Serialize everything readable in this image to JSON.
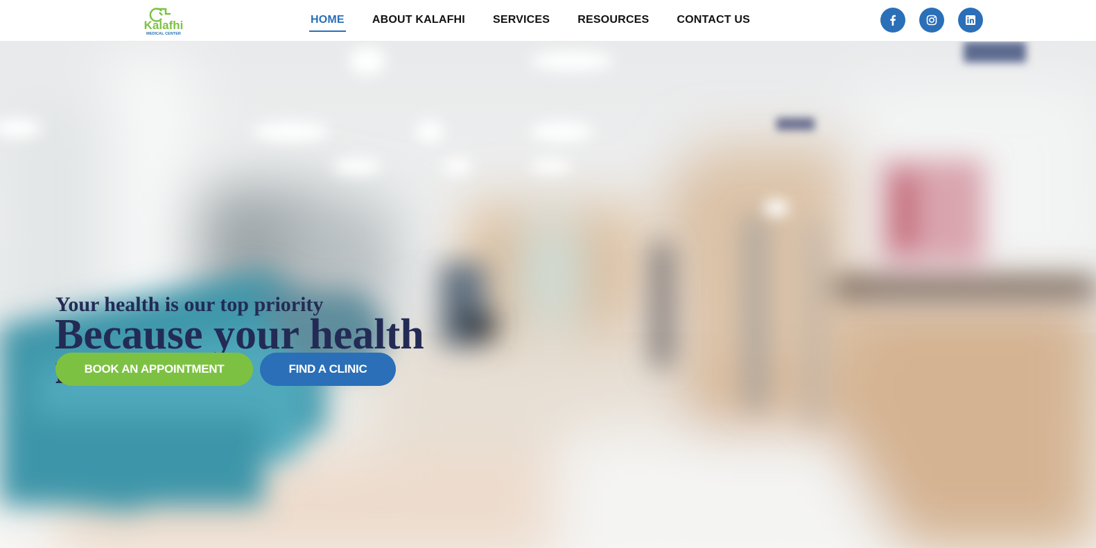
{
  "brand": {
    "logo_name": "Kalafhi",
    "logo_subtitle": "MEDICAL CENTER",
    "green": "#7dc143",
    "blue": "#2a6fb8",
    "navy": "#232b55"
  },
  "nav": {
    "items": [
      {
        "label": "HOME",
        "active": true
      },
      {
        "label": "ABOUT KALAFHI",
        "active": false
      },
      {
        "label": "SERVICES",
        "active": false
      },
      {
        "label": "RESOURCES",
        "active": false
      },
      {
        "label": "CONTACT US",
        "active": false
      }
    ]
  },
  "social": [
    {
      "icon": "facebook-icon"
    },
    {
      "icon": "instagram-icon"
    },
    {
      "icon": "linkedin-icon"
    }
  ],
  "hero": {
    "tagline": "Your health is our top priority",
    "headline": "Because your health matters",
    "primary_cta": "BOOK AN APPOINTMENT",
    "secondary_cta": "FIND A CLINIC"
  }
}
